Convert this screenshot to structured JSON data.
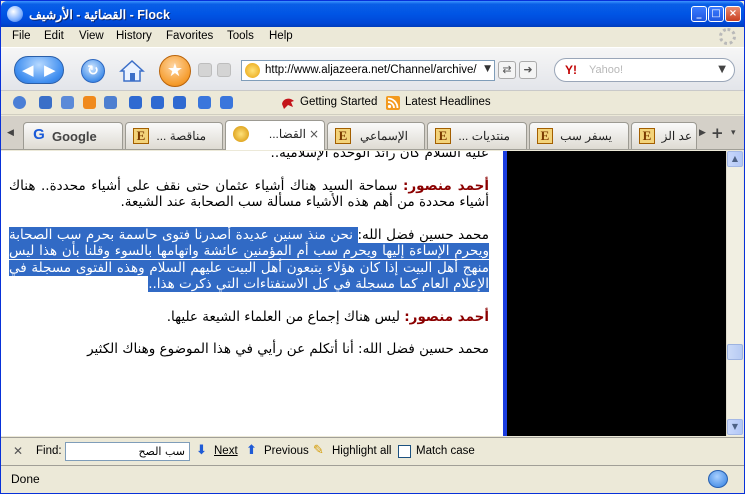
{
  "window": {
    "title": "القضائية - الأرشيف - Flock"
  },
  "menu": [
    "File",
    "Edit",
    "View",
    "History",
    "Favorites",
    "Tools",
    "Help"
  ],
  "address_bar": {
    "url": "http://www.aljazeera.net/Channel/archive/"
  },
  "search": {
    "placeholder": "Yahoo!",
    "engine_logo": "Y!"
  },
  "bookmarks": {
    "getting_started": "Getting Started",
    "latest_headlines": "Latest Headlines"
  },
  "tabs": [
    {
      "label": "Google",
      "icon": "google-icon"
    },
    {
      "label": "مناقصة ...",
      "icon": "e-favicon"
    },
    {
      "label": "القضا...",
      "icon": "aljazeera-favicon",
      "active": true
    },
    {
      "label": "الإسماعي ...",
      "icon": "e-favicon"
    },
    {
      "label": "منتديات ...",
      "icon": "e-favicon"
    },
    {
      "label": "يسفر سب ...",
      "icon": "e-favicon"
    },
    {
      "label": "عد الز",
      "icon": "e-favicon"
    }
  ],
  "article": {
    "top_line": "عليه السلام كان رائد الوحدة الإسلامية..",
    "p1_speaker": "أحمد منصور:",
    "p1_text": " سماحة السيد هناك أشياء عثمان حتى نقف على أشياء محددة.. هناك أشياء محددة من أهم هذه الأشياء مسألة سب الصحابة عند الشيعة.",
    "p2_speaker": "محمد حسين فضل الله:",
    "p2_highlight": " نحن منذ سنين عديدة أصدرنا فتوى حاسمة بحرم سب الصحابة ويحرم الإساءة إليها ويحرم سب أم المؤمنين عائشة واتهامها بالسوء وقلنا بأن هذا ليس منهج أهل البيت إذا كان هؤلاء يتبعون أهل البيت عليهم السلام وهذه الفتوى مسجلة في الإعلام العام كما مسجلة في كل الاستفتاءات التي ذكرت هذا..",
    "p3_speaker": "أحمد منصور:",
    "p3_text": " ليس هناك إجماع من العلماء الشيعة عليها.",
    "p4_speaker": "محمد حسين فضل الله:",
    "p4_text": " أنا أتكلم عن رأيي في هذا الموضوع وهناك الكثير"
  },
  "find_bar": {
    "label": "Find:",
    "value": "سب الصح",
    "next": "Next",
    "previous": "Previous",
    "highlight_all": "Highlight all",
    "match_case": "Match case"
  },
  "status": {
    "text": "Done"
  }
}
